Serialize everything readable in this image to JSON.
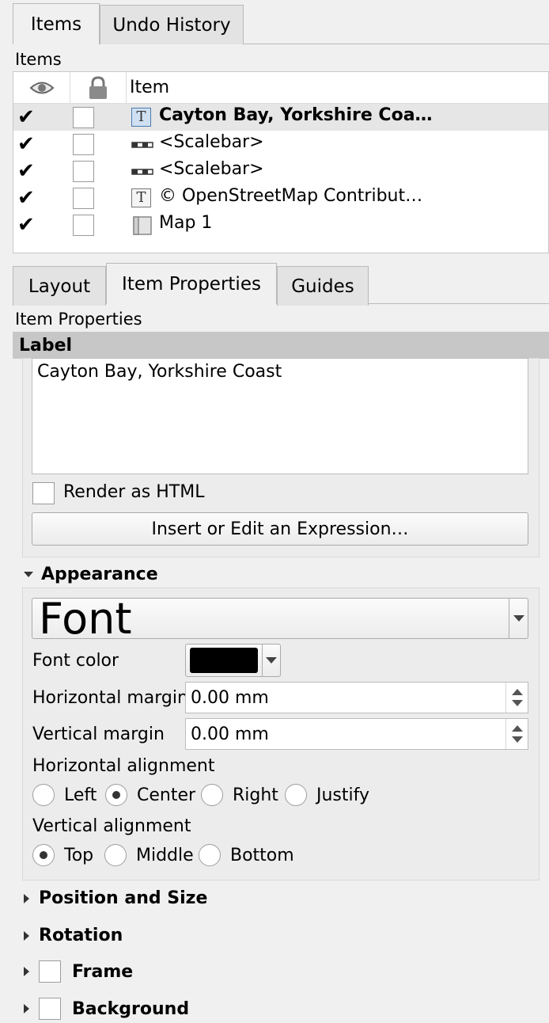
{
  "top_tabs": [
    {
      "label": "Items",
      "active": true
    },
    {
      "label": "Undo History",
      "active": false
    }
  ],
  "items_panel": {
    "title": "Items",
    "column_header": "Item",
    "rows": [
      {
        "label": "Cayton Bay, Yorkshire Coa…",
        "visible": true,
        "locked": false,
        "icon": "text-label-icon",
        "selected": true
      },
      {
        "label": "<Scalebar>",
        "visible": true,
        "locked": false,
        "icon": "scalebar-icon",
        "selected": false
      },
      {
        "label": "<Scalebar>",
        "visible": true,
        "locked": false,
        "icon": "scalebar-icon",
        "selected": false
      },
      {
        "label": "© OpenStreetMap Contribut…",
        "visible": true,
        "locked": false,
        "icon": "text-label-icon",
        "selected": false
      },
      {
        "label": "Map 1",
        "visible": true,
        "locked": false,
        "icon": "map-icon",
        "selected": false
      }
    ]
  },
  "bottom_tabs": [
    {
      "label": "Layout",
      "active": false
    },
    {
      "label": "Item Properties",
      "active": true
    },
    {
      "label": "Guides",
      "active": false
    }
  ],
  "item_properties": {
    "title": "Item Properties",
    "label_section": "Label",
    "label_text": "Cayton Bay, Yorkshire Coast",
    "render_as_html": "Render as HTML",
    "insert_expression": "Insert or Edit an Expression…",
    "appearance": {
      "title": "Appearance",
      "font_button": "Font",
      "font_color_label": "Font color",
      "font_color": "#000000",
      "h_margin_label": "Horizontal margin",
      "h_margin_value": "0.00 mm",
      "v_margin_label": "Vertical margin",
      "v_margin_value": "0.00 mm",
      "h_align_label": "Horizontal alignment",
      "h_align_options": [
        "Left",
        "Center",
        "Right",
        "Justify"
      ],
      "h_align_selected": "Center",
      "v_align_label": "Vertical alignment",
      "v_align_options": [
        "Top",
        "Middle",
        "Bottom"
      ],
      "v_align_selected": "Top"
    },
    "collapsed_groups": {
      "position_size": "Position and Size",
      "rotation": "Rotation",
      "frame": "Frame",
      "background": "Background"
    }
  }
}
